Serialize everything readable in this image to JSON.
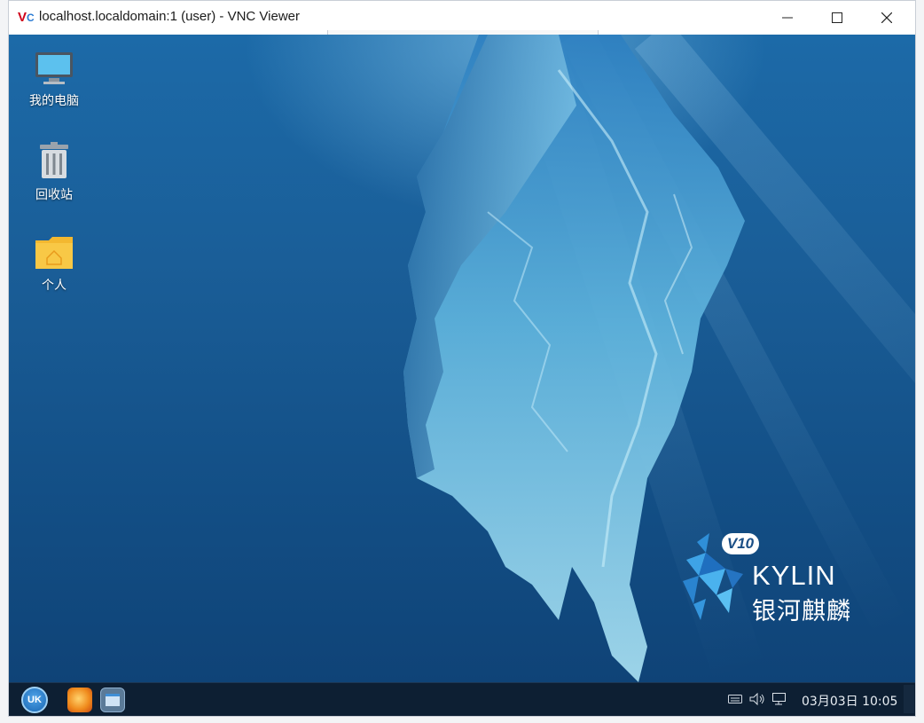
{
  "window": {
    "title": "localhost.localdomain:1 (user) - VNC Viewer",
    "logo_v": "V",
    "logo_c": "C"
  },
  "desktop": {
    "icons": [
      {
        "label": "我的电脑",
        "icon": "computer-icon"
      },
      {
        "label": "回收站",
        "icon": "trash-icon"
      },
      {
        "label": "个人",
        "icon": "home-folder-icon"
      }
    ],
    "brand": {
      "version": "V10",
      "name": "KYLIN",
      "name_cn": "银河麒麟"
    }
  },
  "taskbar": {
    "start_label": "UK",
    "apps": [
      "firefox-icon",
      "file-manager-icon"
    ],
    "tray": [
      "keyboard-icon",
      "volume-icon",
      "network-icon"
    ],
    "clock": "03月03日 10:05"
  },
  "colors": {
    "desktop_top": "#1c6aa8",
    "desktop_bottom": "#0f4377",
    "taskbar": "#0d1f33"
  }
}
